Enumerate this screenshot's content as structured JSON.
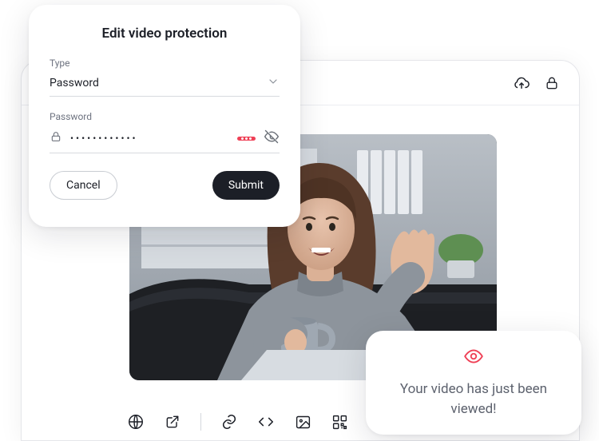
{
  "modal": {
    "title": "Edit video protection",
    "type_label": "Type",
    "type_value": "Password",
    "password_label": "Password",
    "password_masked": "••••••••••••",
    "cancel": "Cancel",
    "submit": "Submit"
  },
  "toast": {
    "message": "Your video has just been viewed!"
  },
  "titlebar": {
    "upload_icon": "cloud-upload",
    "lock_icon": "lock"
  },
  "toolbar": {
    "items": [
      "globe",
      "external-link",
      "link",
      "code",
      "image",
      "qr-code"
    ]
  }
}
